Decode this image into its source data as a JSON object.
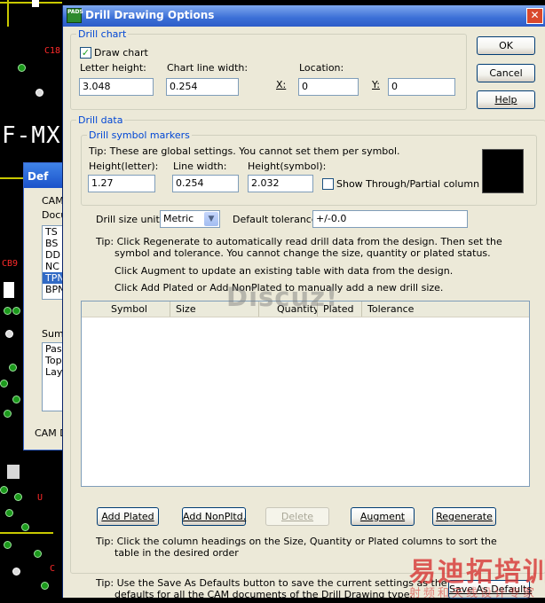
{
  "background": {
    "labels": [
      "C18",
      "F-MX",
      "CB9",
      "U",
      "C"
    ],
    "window_title": "Def",
    "window_labels": [
      "CAM",
      "Docu",
      "Sum",
      "CAM D"
    ],
    "doc_list": [
      "TS",
      "BS",
      "DD",
      "NC",
      "TPN",
      "BPN"
    ],
    "summary_list": [
      "Pas",
      "Top",
      "Lay"
    ]
  },
  "dialog": {
    "app_icon_text": "PADS",
    "title": "Drill Drawing Options",
    "close_glyph": "✕"
  },
  "drill_chart": {
    "group_label": "Drill chart",
    "draw_chart_label": "Draw chart",
    "draw_chart_checked": true,
    "check_glyph": "✓",
    "letter_height_label": "Letter height:",
    "letter_height_value": "3.048",
    "chart_line_width_label": "Chart line width:",
    "chart_line_width_value": "0.254",
    "location_label": "Location:",
    "x_label": "X:",
    "x_value": "0",
    "y_label": "Y:",
    "y_value": "0"
  },
  "buttons_right": {
    "ok": "OK",
    "cancel": "Cancel",
    "help": "Help"
  },
  "drill_data": {
    "group_label": "Drill data",
    "symbol_markers": {
      "group_label": "Drill symbol markers",
      "tip": "Tip: These are global settings. You cannot set them per symbol.",
      "height_letter_label": "Height(letter):",
      "height_letter_value": "1.27",
      "line_width_label": "Line width:",
      "line_width_value": "0.254",
      "height_symbol_label": "Height(symbol):",
      "height_symbol_value": "2.032",
      "show_through_label": "Show Through/Partial column",
      "show_through_checked": false,
      "color": "#000000"
    },
    "drill_size_units_label": "Drill size units:",
    "drill_size_units_value": "Metric",
    "default_tolerance_label": "Default tolerance:",
    "default_tolerance_value": "+/-0.0",
    "tip_regenerate_1": "Tip: Click Regenerate to automatically read drill data from the design. Then set the",
    "tip_regenerate_2": "symbol and tolerance. You cannot change the size, quantity or plated status.",
    "tip_augment": "Click Augment to update an existing table with data from the design.",
    "tip_add": "Click Add Plated or Add NonPlated to manually add a new drill size.",
    "table_columns": [
      "Symbol",
      "Size",
      "Quantity",
      "Plated",
      "Tolerance"
    ],
    "table_rows": [],
    "actions": {
      "add_plated": "Add Plated",
      "add_nonplated": "Add NonPltd.",
      "delete": "Delete",
      "augment": "Augment",
      "regenerate": "Regenerate"
    },
    "tip_columns_1": "Tip: Click the column headings on the Size, Quantity or Plated columns to sort the",
    "tip_columns_2": "table in the desired order"
  },
  "footer": {
    "tip_1": "Tip: Use the Save As Defaults button to save the current settings as the",
    "tip_2": "defaults for all the CAM documents of the Drill Drawing type.",
    "save_defaults": "Save As Defaults"
  },
  "watermarks": {
    "forum": "Discuz!",
    "brand_line1": "易迪拓培训",
    "brand_line2": "射频和天线设计专家"
  }
}
